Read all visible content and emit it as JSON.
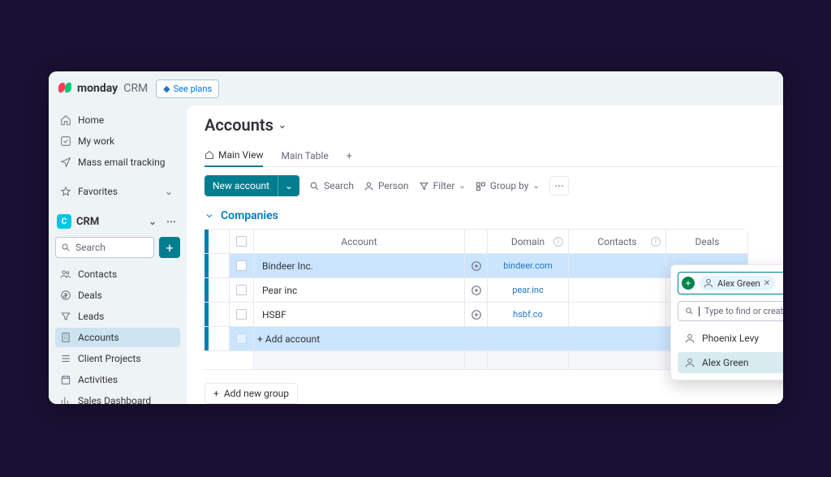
{
  "brand": {
    "name": "monday",
    "sub": "CRM",
    "see_plans": "See plans"
  },
  "sidebar": {
    "nav": [
      {
        "label": "Home"
      },
      {
        "label": "My work"
      },
      {
        "label": "Mass email tracking"
      }
    ],
    "favorites_label": "Favorites",
    "workspace": "CRM",
    "search_placeholder": "Search",
    "items": [
      {
        "label": "Contacts"
      },
      {
        "label": "Deals"
      },
      {
        "label": "Leads"
      },
      {
        "label": "Accounts"
      },
      {
        "label": "Client Projects"
      },
      {
        "label": "Activities"
      },
      {
        "label": "Sales Dashboard"
      }
    ]
  },
  "page": {
    "title": "Accounts",
    "tabs": [
      {
        "label": "Main View"
      },
      {
        "label": "Main Table"
      }
    ],
    "toolbar": {
      "new_label": "New account",
      "search": "Search",
      "person": "Person",
      "filter": "Filter",
      "group_by": "Group by"
    },
    "group_title": "Companies",
    "columns": {
      "account": "Account",
      "domain": "Domain",
      "contacts": "Contacts",
      "deals": "Deals"
    },
    "rows": [
      {
        "name": "Bindeer Inc.",
        "domain": "bindeer.com"
      },
      {
        "name": "Pear inc",
        "domain": "pear.inc"
      },
      {
        "name": "HSBF",
        "domain": "hsbf.co"
      }
    ],
    "add_account": "+ Add account",
    "add_group": "Add new group"
  },
  "popover": {
    "chip": "Alex Green",
    "search_placeholder": "Type to find or create Contacts",
    "options": [
      "Phoenix Levy",
      "Alex Green"
    ]
  }
}
